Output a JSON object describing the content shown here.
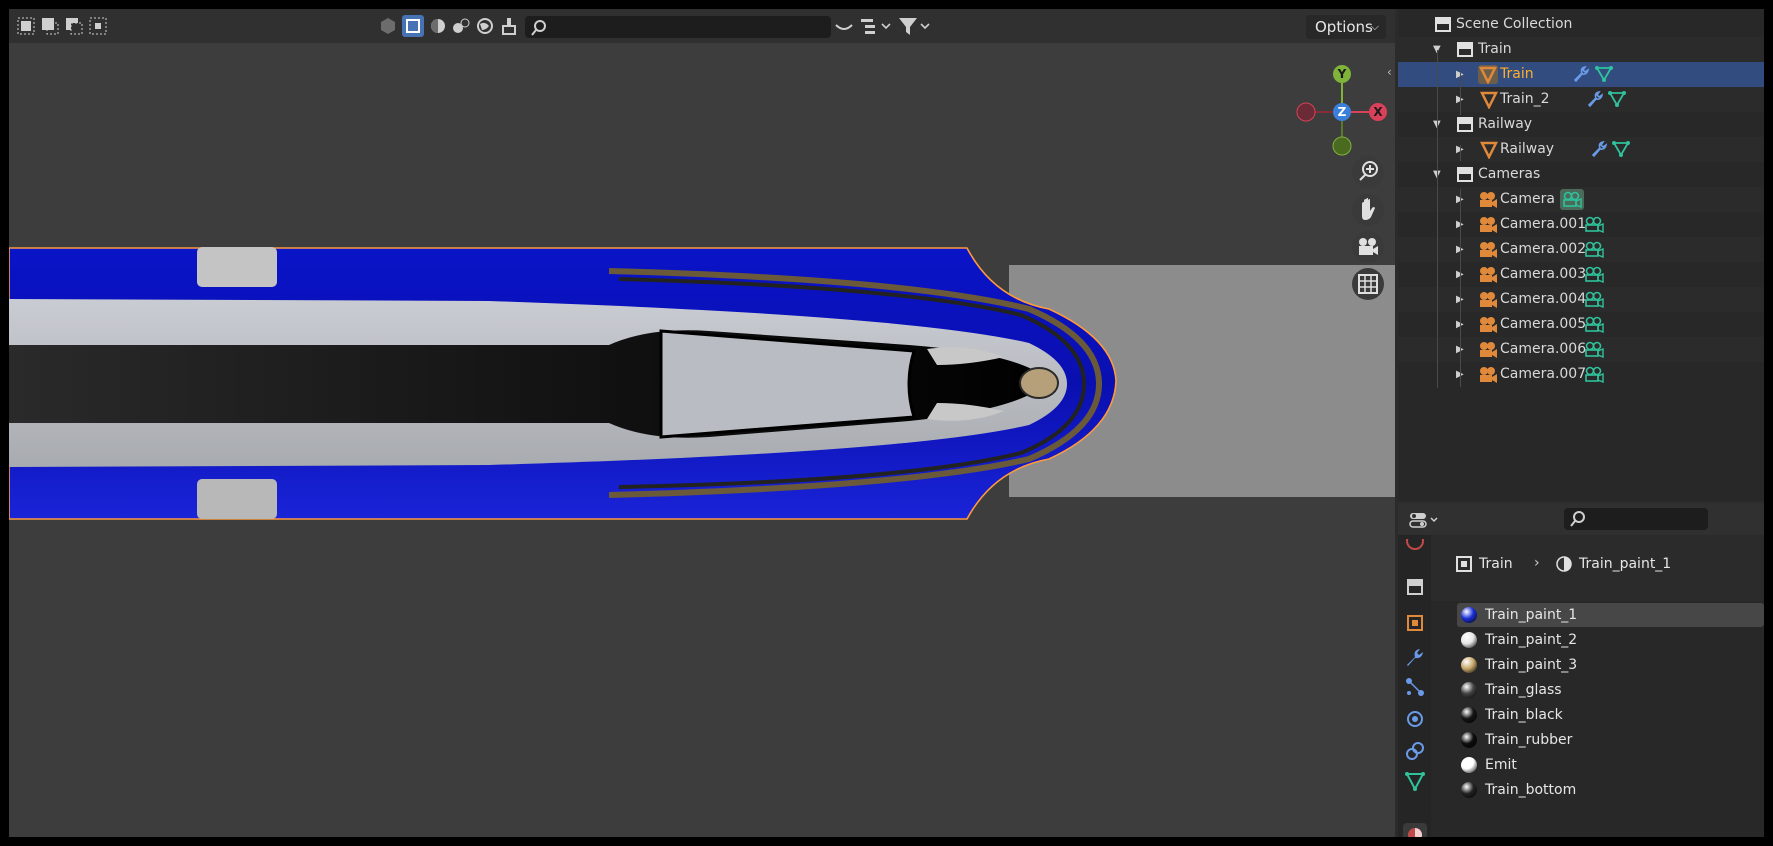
{
  "viewport": {
    "header": {
      "search_placeholder": "",
      "options_label": "Options",
      "icons": [
        "select-new-icon",
        "select-extend-icon",
        "select-subtract-icon",
        "select-intersect-icon",
        "wireframe-shading-icon",
        "solid-shading-icon",
        "material-shading-icon",
        "rendered-shading-icon",
        "world-icon",
        "cleanup-icon",
        "search-icon",
        "overlay-icon",
        "hierarchy-icon",
        "filter-icon"
      ]
    },
    "gizmo": {
      "y_label": "Y",
      "x_label": "X",
      "z_label": "Z"
    },
    "nav_icons": [
      "zoom-icon",
      "pan-hand-icon",
      "camera-view-icon",
      "grid-ortho-icon"
    ]
  },
  "outliner": {
    "rows": [
      {
        "label": "Scene Collection",
        "type": "scene"
      },
      {
        "label": "Train",
        "type": "collection"
      },
      {
        "label": "Train",
        "type": "mesh",
        "selected": true
      },
      {
        "label": "Train_2",
        "type": "mesh"
      },
      {
        "label": "Railway",
        "type": "collection"
      },
      {
        "label": "Railway",
        "type": "mesh"
      },
      {
        "label": "Cameras",
        "type": "collection"
      },
      {
        "label": "Camera",
        "type": "camera"
      },
      {
        "label": "Camera.001",
        "type": "camera"
      },
      {
        "label": "Camera.002",
        "type": "camera"
      },
      {
        "label": "Camera.003",
        "type": "camera"
      },
      {
        "label": "Camera.004",
        "type": "camera"
      },
      {
        "label": "Camera.005",
        "type": "camera"
      },
      {
        "label": "Camera.006",
        "type": "camera"
      },
      {
        "label": "Camera.007",
        "type": "camera"
      }
    ]
  },
  "properties": {
    "breadcrumb": {
      "object": "Train",
      "material": "Train_paint_1"
    },
    "materials": [
      {
        "label": "Train_paint_1",
        "color": "#1a2fd6",
        "selected": true
      },
      {
        "label": "Train_paint_2",
        "color": "#e6e6e6"
      },
      {
        "label": "Train_paint_3",
        "color": "#c8a96a"
      },
      {
        "label": "Train_glass",
        "color": "#444444"
      },
      {
        "label": "Train_black",
        "color": "#151515"
      },
      {
        "label": "Train_rubber",
        "color": "#0d0d0d"
      },
      {
        "label": "Emit",
        "color": "#ffffff"
      },
      {
        "label": "Train_bottom",
        "color": "#222222"
      }
    ],
    "tab_icons": [
      "scene-icon",
      "collection-icon",
      "object-icon",
      "modifier-wrench-icon",
      "particles-icon",
      "physics-icon",
      "constraints-icon",
      "data-mesh-icon",
      "material-icon"
    ]
  },
  "colors": {
    "accent_select": "#334c7f",
    "object_orange": "#e0893a",
    "mesh_green": "#2fc29b",
    "modifier_blue": "#6a9be8"
  }
}
